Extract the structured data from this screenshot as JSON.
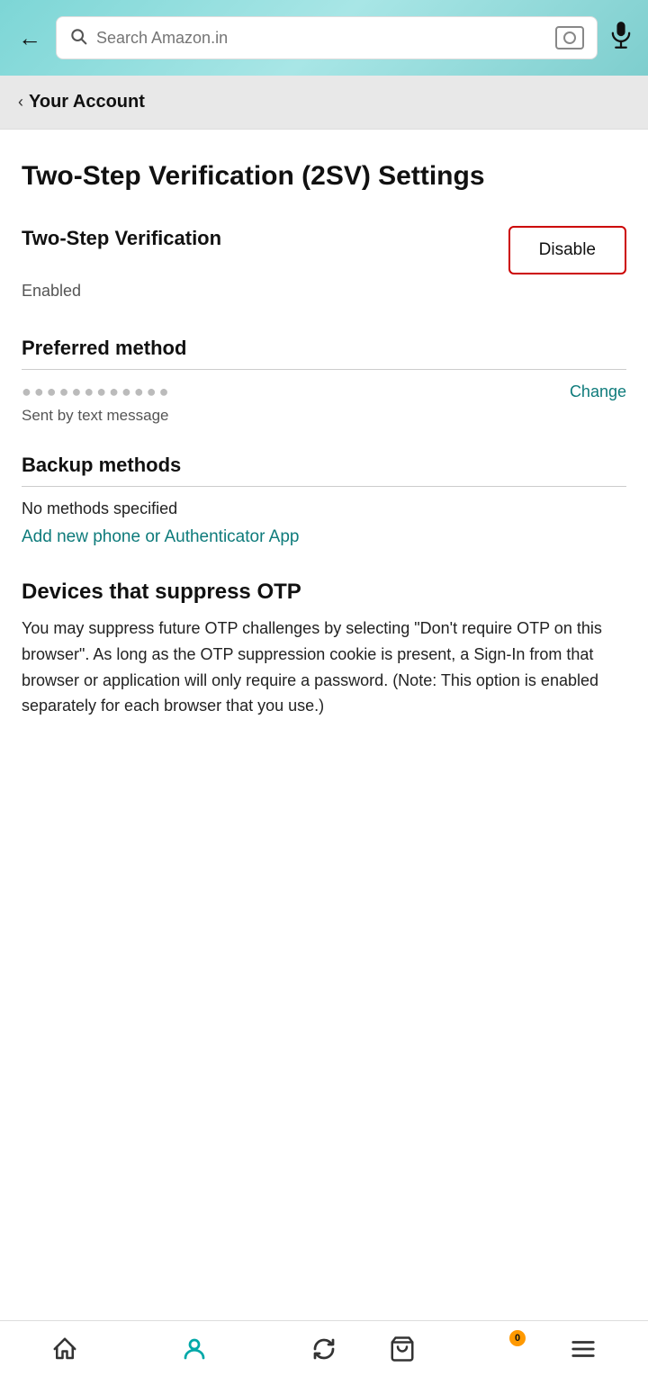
{
  "header": {
    "search_placeholder": "Search Amazon.in",
    "back_label": "←"
  },
  "breadcrumb": {
    "arrow": "‹",
    "label": "Your Account"
  },
  "page": {
    "title": "Two-Step Verification (2SV) Settings"
  },
  "tsv": {
    "heading": "Two-Step Verification",
    "status": "Enabled",
    "disable_btn": "Disable"
  },
  "preferred": {
    "section_title": "Preferred method",
    "phone_redacted": "●●●●●●●●●●●●",
    "change_link": "Change",
    "method_desc": "Sent by text message"
  },
  "backup": {
    "section_title": "Backup methods",
    "no_methods": "No methods specified",
    "add_link": "Add new phone or Authenticator App"
  },
  "devices": {
    "section_title": "Devices that suppress OTP",
    "description": "You may suppress future OTP challenges by selecting \"Don't require OTP on this browser\". As long as the OTP suppression cookie is present, a Sign-In from that browser or application will only require a password. (Note: This option is enabled separately for each browser that you use.)"
  },
  "bottom_nav": {
    "cart_count": "0"
  }
}
